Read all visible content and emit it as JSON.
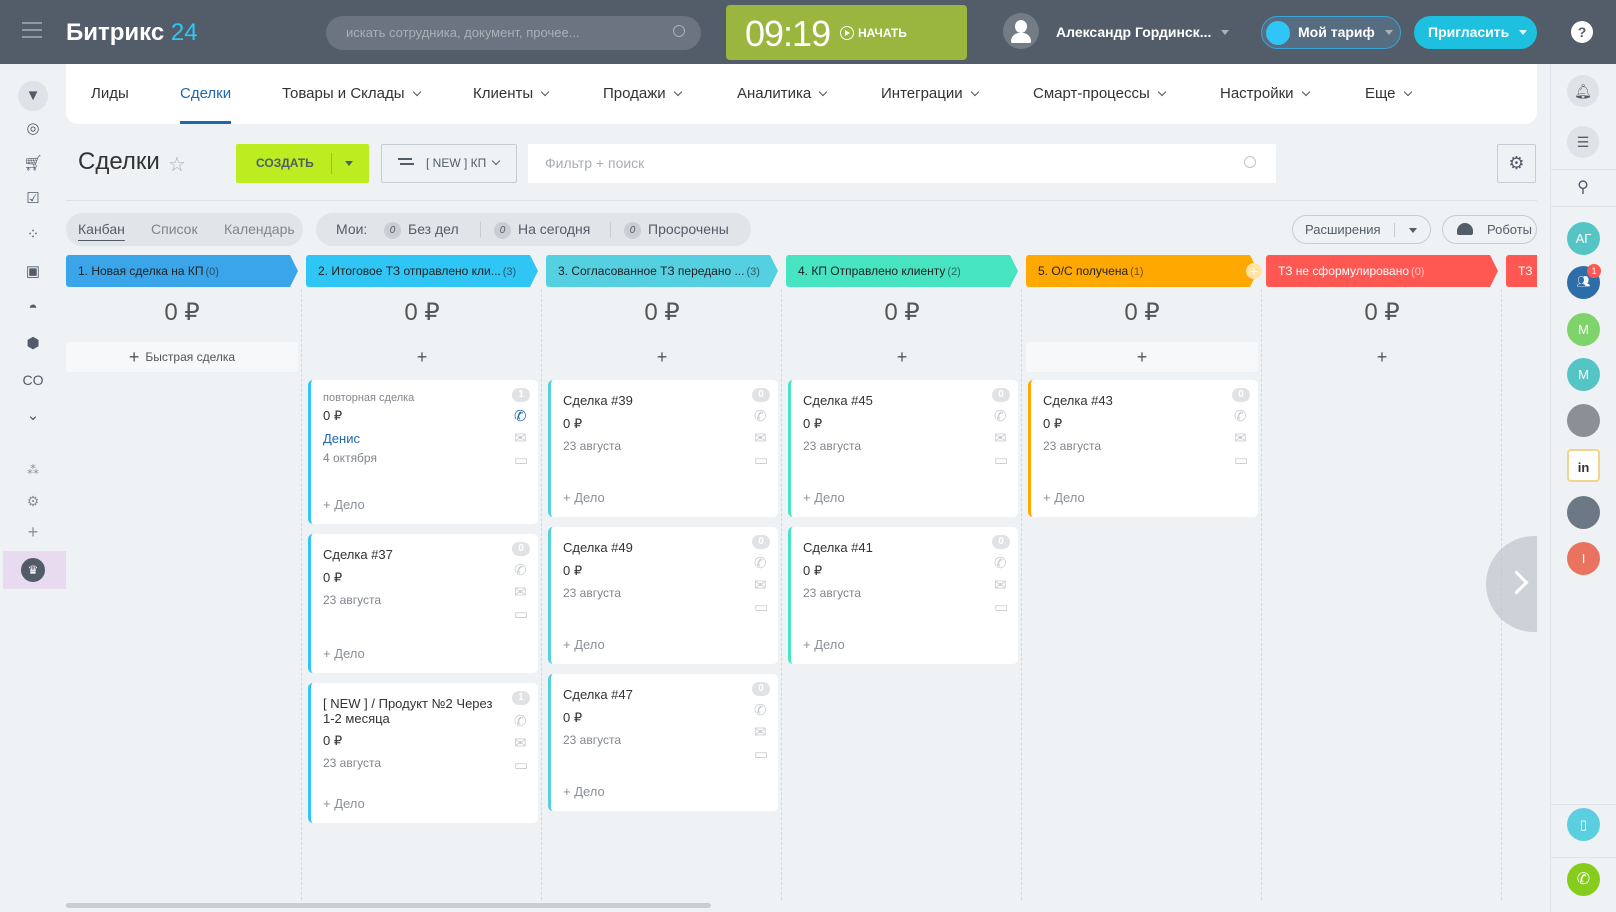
{
  "header": {
    "logo_main": "Битрикс",
    "logo_num": "24",
    "search_placeholder": "искать сотрудника, документ, прочее...",
    "time": "09:19",
    "start": "НАЧАТЬ",
    "user": "Александр Гординск...",
    "tariff": "Мой тариф",
    "invite": "Пригласить",
    "help": "?"
  },
  "nav": [
    "Лиды",
    "Сделки",
    "Товары и Склады",
    "Клиенты",
    "Продажи",
    "Аналитика",
    "Интеграции",
    "Смарт-процессы",
    "Настройки",
    "Еще"
  ],
  "nav_active": 1,
  "left_sidebar": {
    "co_label": "CO"
  },
  "toolbar": {
    "title": "Сделки",
    "create": "СОЗДАТЬ",
    "preset": "[ NEW ] КП",
    "filter_placeholder": "Фильтр + поиск"
  },
  "views": {
    "kanban": "Канбан",
    "list": "Список",
    "calendar": "Календарь"
  },
  "counters": {
    "label": "Мои:",
    "no_tasks": {
      "n": "0",
      "label": "Без дел"
    },
    "today": {
      "n": "0",
      "label": "На сегодня"
    },
    "overdue": {
      "n": "0",
      "label": "Просрочены"
    }
  },
  "extensions": "Расширения",
  "robots": "Роботы",
  "quick_deal": "Быстрая сделка",
  "add_task": "+ Дело",
  "columns": [
    {
      "title": "1. Новая сделка на КП",
      "count": "(0)",
      "color": "#3aa5e8",
      "text": "#222",
      "sum": "0 ₽",
      "quick": true,
      "cards": []
    },
    {
      "title": "2. Итоговое ТЗ отправлено кли...",
      "count": "(3)",
      "color": "#2fc6f6",
      "text": "#222",
      "sum": "0 ₽",
      "cards": [
        {
          "subtitle": "повторная сделка",
          "amount": "0 ₽",
          "contact": "Денис",
          "date": "4 октября",
          "badge": "1",
          "phone_active": true
        },
        {
          "title": "Сделка #37",
          "amount": "0 ₽",
          "date": "23 августа",
          "badge": "0"
        },
        {
          "title": "[ NEW ] / Продукт №2 Через 1-2 месяца",
          "amount": "0 ₽",
          "date": "23 августа",
          "badge": "1"
        }
      ]
    },
    {
      "title": "3. Согласованное ТЗ передано ...",
      "count": "(3)",
      "color": "#55d0e0",
      "text": "#222",
      "sum": "0 ₽",
      "cards": [
        {
          "title": "Сделка #39",
          "amount": "0 ₽",
          "date": "23 августа",
          "badge": "0"
        },
        {
          "title": "Сделка #49",
          "amount": "0 ₽",
          "date": "23 августа",
          "badge": "0"
        },
        {
          "title": "Сделка #47",
          "amount": "0 ₽",
          "date": "23 августа",
          "badge": "0"
        }
      ]
    },
    {
      "title": "4. КП Отправлено клиенту",
      "count": "(2)",
      "color": "#47e4c2",
      "text": "#222",
      "sum": "0 ₽",
      "cards": [
        {
          "title": "Сделка #45",
          "amount": "0 ₽",
          "date": "23 августа",
          "badge": "0"
        },
        {
          "title": "Сделка #41",
          "amount": "0 ₽",
          "date": "23 августа",
          "badge": "0"
        }
      ]
    },
    {
      "title": "5. О/С получена",
      "count": "(1)",
      "color": "#ffa900",
      "text": "#222",
      "sum": "0 ₽",
      "addbg": true,
      "cards": [
        {
          "title": "Сделка #43",
          "amount": "0 ₽",
          "date": "23 августа",
          "badge": "0"
        }
      ]
    },
    {
      "title": "ТЗ не сформулировано",
      "count": "(0)",
      "color": "#ff5752",
      "text": "#fff",
      "sum": "0 ₽",
      "cards": []
    },
    {
      "title": "ТЗ",
      "count": "",
      "color": "#ff5752",
      "text": "#fff",
      "sum": "",
      "cards": []
    }
  ],
  "right_sidebar": {
    "avatars": [
      {
        "initials": "АГ",
        "color": "#55c4c4"
      },
      {
        "initials": "M",
        "color": "#7fd36b"
      },
      {
        "initials": "M",
        "color": "#55c4c4"
      },
      {
        "initials": "I",
        "color": "#e9735f"
      }
    ],
    "chat_badge": "1"
  }
}
